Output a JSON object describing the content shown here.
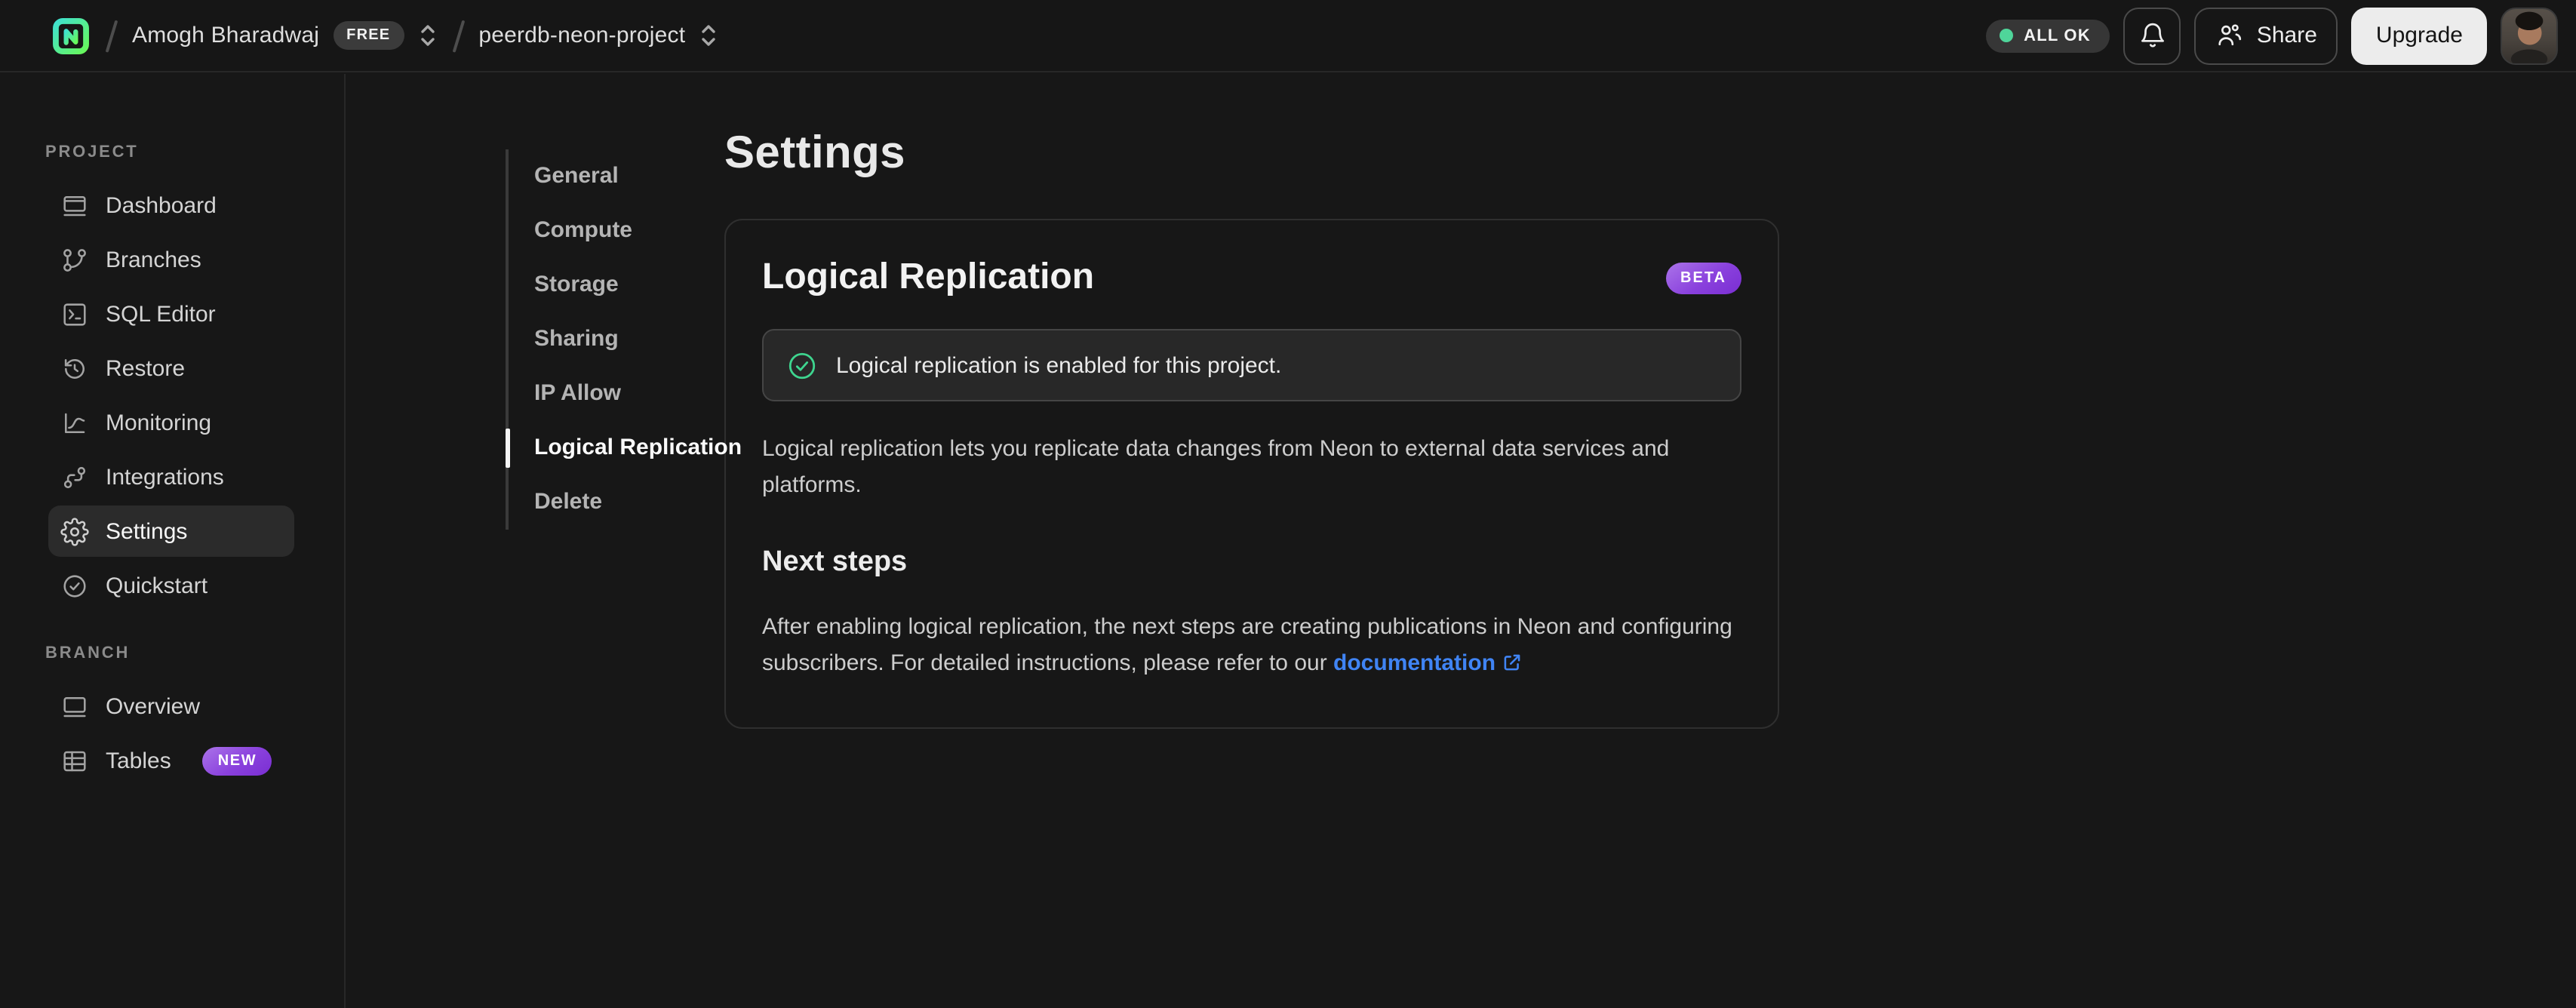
{
  "topbar": {
    "breadcrumb": {
      "org_name": "Amogh Bharadwaj",
      "org_badge": "FREE",
      "project_name": "peerdb-neon-project"
    },
    "status_pill": "ALL OK",
    "share_label": "Share",
    "upgrade_label": "Upgrade"
  },
  "sidebar": {
    "sections": [
      {
        "label": "PROJECT",
        "items": [
          {
            "label": "Dashboard",
            "icon": "dashboard-icon"
          },
          {
            "label": "Branches",
            "icon": "git-branch-icon"
          },
          {
            "label": "SQL Editor",
            "icon": "sql-terminal-icon"
          },
          {
            "label": "Restore",
            "icon": "history-clock-icon"
          },
          {
            "label": "Monitoring",
            "icon": "chart-curve-icon"
          },
          {
            "label": "Integrations",
            "icon": "workflow-icon"
          },
          {
            "label": "Settings",
            "icon": "gear-icon",
            "active": true
          },
          {
            "label": "Quickstart",
            "icon": "check-circle-icon"
          }
        ]
      },
      {
        "label": "BRANCH",
        "items": [
          {
            "label": "Overview",
            "icon": "browser-window-icon"
          },
          {
            "label": "Tables",
            "icon": "table-grid-icon",
            "badge": "NEW"
          }
        ]
      }
    ]
  },
  "settings_nav": {
    "items": [
      "General",
      "Compute",
      "Storage",
      "Sharing",
      "IP Allow",
      "Logical Replication",
      "Delete"
    ],
    "active": "Logical Replication"
  },
  "main": {
    "page_title": "Settings",
    "card": {
      "title": "Logical Replication",
      "badge": "BETA",
      "banner_text": "Logical replication is enabled for this project.",
      "intro": "Logical replication lets you replicate data changes from Neon to external data services and platforms.",
      "next_steps_heading": "Next steps",
      "next_steps_text": "After enabling logical replication, the next steps are creating publications in Neon and configuring subscribers. For detailed instructions, please refer to our ",
      "doc_link_label": "documentation"
    }
  },
  "colors": {
    "status_green": "#4fd59a",
    "success_green": "#3ed58f",
    "badge_purple_gradient": [
      "#ab74e9",
      "#7a2ed2"
    ],
    "link_blue": "#4084f4",
    "background": "#161616"
  }
}
